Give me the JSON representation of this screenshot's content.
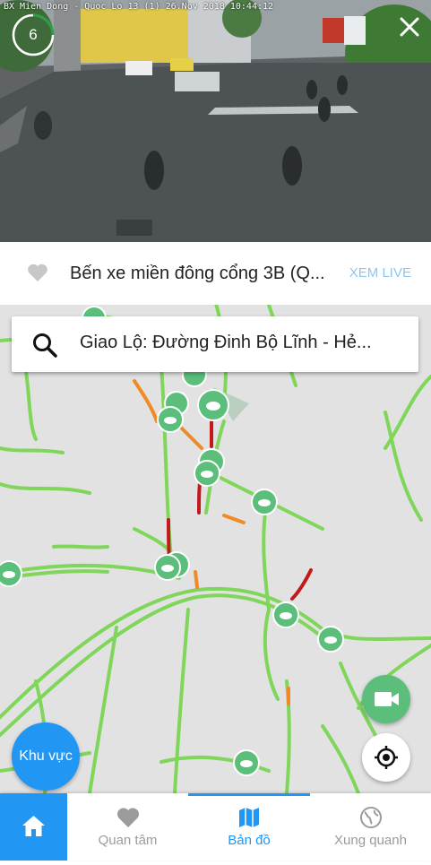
{
  "camera": {
    "osd_text": "BX Mien Dong - Quoc Lo 13 (1)  26.Nov 2018  10:44:12",
    "countdown": "6"
  },
  "info": {
    "camera_name": "Bến xe miền đông cổng 3B (Q...",
    "live_button": "XEM LIVE"
  },
  "search": {
    "text": "Giao Lộ: Đường Đinh Bộ Lĩnh - Hẻ..."
  },
  "map": {
    "area_button": "Khu vực"
  },
  "nav": {
    "items": [
      {
        "label": "Quan tâm",
        "icon": "heart-icon"
      },
      {
        "label": "Bản đồ",
        "icon": "map-icon"
      },
      {
        "label": "Xung quanh",
        "icon": "globe-icon"
      }
    ],
    "active": "Bản đồ"
  },
  "colors": {
    "accent": "#2196f3",
    "road_green": "#7fd65a",
    "congestion_red": "#c21a1a",
    "congestion_orange": "#f08a24",
    "camera_marker": "#5bbf7b"
  }
}
